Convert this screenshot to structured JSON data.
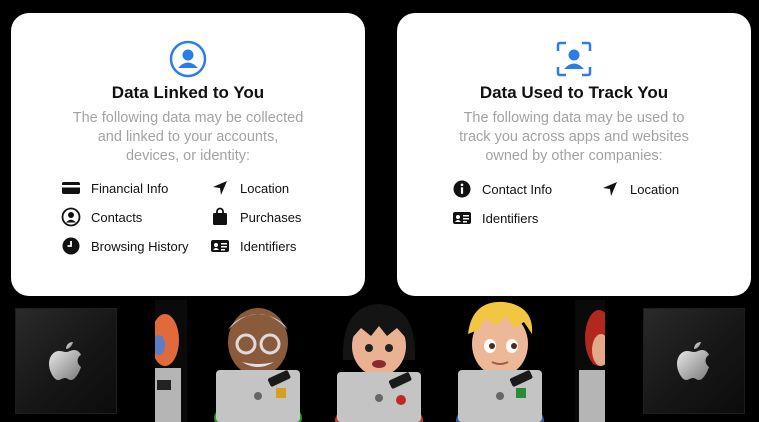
{
  "cards": {
    "linked": {
      "title": "Data Linked to You",
      "desc_lines": [
        "The following data may be collected",
        "and linked to your accounts,",
        "devices, or identity:"
      ],
      "items": [
        {
          "label": "Financial Info",
          "icon": "credit-card-icon"
        },
        {
          "label": "Location",
          "icon": "location-arrow-icon"
        },
        {
          "label": "Contacts",
          "icon": "contact-person-icon"
        },
        {
          "label": "Purchases",
          "icon": "shopping-bag-icon"
        },
        {
          "label": "Browsing History",
          "icon": "clock-icon"
        },
        {
          "label": "Identifiers",
          "icon": "id-card-icon"
        }
      ]
    },
    "tracking": {
      "title": "Data Used to Track You",
      "desc_lines": [
        "The following data may be used to",
        "track you across apps and websites",
        "owned by other companies:"
      ],
      "items": [
        {
          "label": "Contact Info",
          "icon": "info-circle-icon"
        },
        {
          "label": "Location",
          "icon": "location-arrow-icon"
        },
        {
          "label": "Identifiers",
          "icon": "id-card-icon"
        }
      ]
    }
  },
  "colors": {
    "accent": "#2b7de9",
    "card": "#ffffff",
    "background": "#000000",
    "muted_text": "#a3a3a3"
  }
}
